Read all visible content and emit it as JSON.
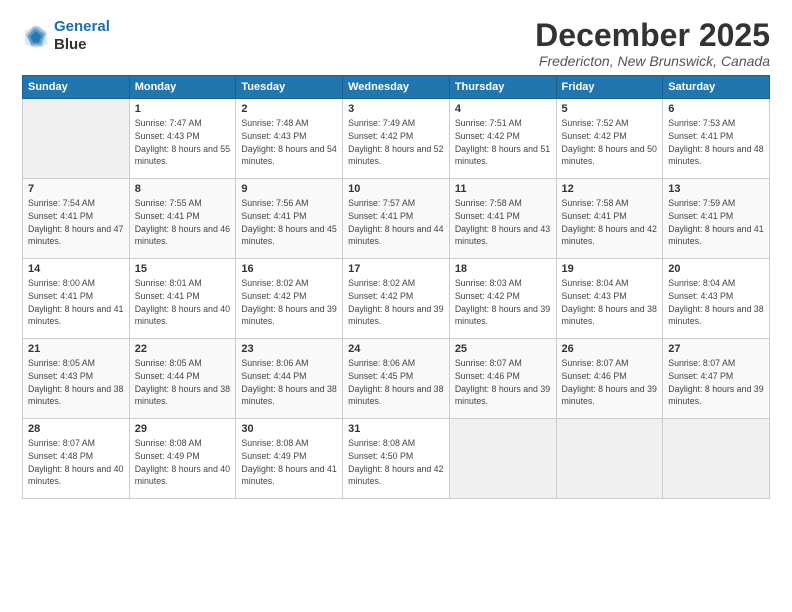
{
  "logo": {
    "line1": "General",
    "line2": "Blue"
  },
  "header": {
    "title": "December 2025",
    "subtitle": "Fredericton, New Brunswick, Canada"
  },
  "weekdays": [
    "Sunday",
    "Monday",
    "Tuesday",
    "Wednesday",
    "Thursday",
    "Friday",
    "Saturday"
  ],
  "weeks": [
    [
      {
        "day": "",
        "sunrise": "",
        "sunset": "",
        "daylight": ""
      },
      {
        "day": "1",
        "sunrise": "Sunrise: 7:47 AM",
        "sunset": "Sunset: 4:43 PM",
        "daylight": "Daylight: 8 hours and 55 minutes."
      },
      {
        "day": "2",
        "sunrise": "Sunrise: 7:48 AM",
        "sunset": "Sunset: 4:43 PM",
        "daylight": "Daylight: 8 hours and 54 minutes."
      },
      {
        "day": "3",
        "sunrise": "Sunrise: 7:49 AM",
        "sunset": "Sunset: 4:42 PM",
        "daylight": "Daylight: 8 hours and 52 minutes."
      },
      {
        "day": "4",
        "sunrise": "Sunrise: 7:51 AM",
        "sunset": "Sunset: 4:42 PM",
        "daylight": "Daylight: 8 hours and 51 minutes."
      },
      {
        "day": "5",
        "sunrise": "Sunrise: 7:52 AM",
        "sunset": "Sunset: 4:42 PM",
        "daylight": "Daylight: 8 hours and 50 minutes."
      },
      {
        "day": "6",
        "sunrise": "Sunrise: 7:53 AM",
        "sunset": "Sunset: 4:41 PM",
        "daylight": "Daylight: 8 hours and 48 minutes."
      }
    ],
    [
      {
        "day": "7",
        "sunrise": "Sunrise: 7:54 AM",
        "sunset": "Sunset: 4:41 PM",
        "daylight": "Daylight: 8 hours and 47 minutes."
      },
      {
        "day": "8",
        "sunrise": "Sunrise: 7:55 AM",
        "sunset": "Sunset: 4:41 PM",
        "daylight": "Daylight: 8 hours and 46 minutes."
      },
      {
        "day": "9",
        "sunrise": "Sunrise: 7:56 AM",
        "sunset": "Sunset: 4:41 PM",
        "daylight": "Daylight: 8 hours and 45 minutes."
      },
      {
        "day": "10",
        "sunrise": "Sunrise: 7:57 AM",
        "sunset": "Sunset: 4:41 PM",
        "daylight": "Daylight: 8 hours and 44 minutes."
      },
      {
        "day": "11",
        "sunrise": "Sunrise: 7:58 AM",
        "sunset": "Sunset: 4:41 PM",
        "daylight": "Daylight: 8 hours and 43 minutes."
      },
      {
        "day": "12",
        "sunrise": "Sunrise: 7:58 AM",
        "sunset": "Sunset: 4:41 PM",
        "daylight": "Daylight: 8 hours and 42 minutes."
      },
      {
        "day": "13",
        "sunrise": "Sunrise: 7:59 AM",
        "sunset": "Sunset: 4:41 PM",
        "daylight": "Daylight: 8 hours and 41 minutes."
      }
    ],
    [
      {
        "day": "14",
        "sunrise": "Sunrise: 8:00 AM",
        "sunset": "Sunset: 4:41 PM",
        "daylight": "Daylight: 8 hours and 41 minutes."
      },
      {
        "day": "15",
        "sunrise": "Sunrise: 8:01 AM",
        "sunset": "Sunset: 4:41 PM",
        "daylight": "Daylight: 8 hours and 40 minutes."
      },
      {
        "day": "16",
        "sunrise": "Sunrise: 8:02 AM",
        "sunset": "Sunset: 4:42 PM",
        "daylight": "Daylight: 8 hours and 39 minutes."
      },
      {
        "day": "17",
        "sunrise": "Sunrise: 8:02 AM",
        "sunset": "Sunset: 4:42 PM",
        "daylight": "Daylight: 8 hours and 39 minutes."
      },
      {
        "day": "18",
        "sunrise": "Sunrise: 8:03 AM",
        "sunset": "Sunset: 4:42 PM",
        "daylight": "Daylight: 8 hours and 39 minutes."
      },
      {
        "day": "19",
        "sunrise": "Sunrise: 8:04 AM",
        "sunset": "Sunset: 4:43 PM",
        "daylight": "Daylight: 8 hours and 38 minutes."
      },
      {
        "day": "20",
        "sunrise": "Sunrise: 8:04 AM",
        "sunset": "Sunset: 4:43 PM",
        "daylight": "Daylight: 8 hours and 38 minutes."
      }
    ],
    [
      {
        "day": "21",
        "sunrise": "Sunrise: 8:05 AM",
        "sunset": "Sunset: 4:43 PM",
        "daylight": "Daylight: 8 hours and 38 minutes."
      },
      {
        "day": "22",
        "sunrise": "Sunrise: 8:05 AM",
        "sunset": "Sunset: 4:44 PM",
        "daylight": "Daylight: 8 hours and 38 minutes."
      },
      {
        "day": "23",
        "sunrise": "Sunrise: 8:06 AM",
        "sunset": "Sunset: 4:44 PM",
        "daylight": "Daylight: 8 hours and 38 minutes."
      },
      {
        "day": "24",
        "sunrise": "Sunrise: 8:06 AM",
        "sunset": "Sunset: 4:45 PM",
        "daylight": "Daylight: 8 hours and 38 minutes."
      },
      {
        "day": "25",
        "sunrise": "Sunrise: 8:07 AM",
        "sunset": "Sunset: 4:46 PM",
        "daylight": "Daylight: 8 hours and 39 minutes."
      },
      {
        "day": "26",
        "sunrise": "Sunrise: 8:07 AM",
        "sunset": "Sunset: 4:46 PM",
        "daylight": "Daylight: 8 hours and 39 minutes."
      },
      {
        "day": "27",
        "sunrise": "Sunrise: 8:07 AM",
        "sunset": "Sunset: 4:47 PM",
        "daylight": "Daylight: 8 hours and 39 minutes."
      }
    ],
    [
      {
        "day": "28",
        "sunrise": "Sunrise: 8:07 AM",
        "sunset": "Sunset: 4:48 PM",
        "daylight": "Daylight: 8 hours and 40 minutes."
      },
      {
        "day": "29",
        "sunrise": "Sunrise: 8:08 AM",
        "sunset": "Sunset: 4:49 PM",
        "daylight": "Daylight: 8 hours and 40 minutes."
      },
      {
        "day": "30",
        "sunrise": "Sunrise: 8:08 AM",
        "sunset": "Sunset: 4:49 PM",
        "daylight": "Daylight: 8 hours and 41 minutes."
      },
      {
        "day": "31",
        "sunrise": "Sunrise: 8:08 AM",
        "sunset": "Sunset: 4:50 PM",
        "daylight": "Daylight: 8 hours and 42 minutes."
      },
      {
        "day": "",
        "sunrise": "",
        "sunset": "",
        "daylight": ""
      },
      {
        "day": "",
        "sunrise": "",
        "sunset": "",
        "daylight": ""
      },
      {
        "day": "",
        "sunrise": "",
        "sunset": "",
        "daylight": ""
      }
    ]
  ]
}
